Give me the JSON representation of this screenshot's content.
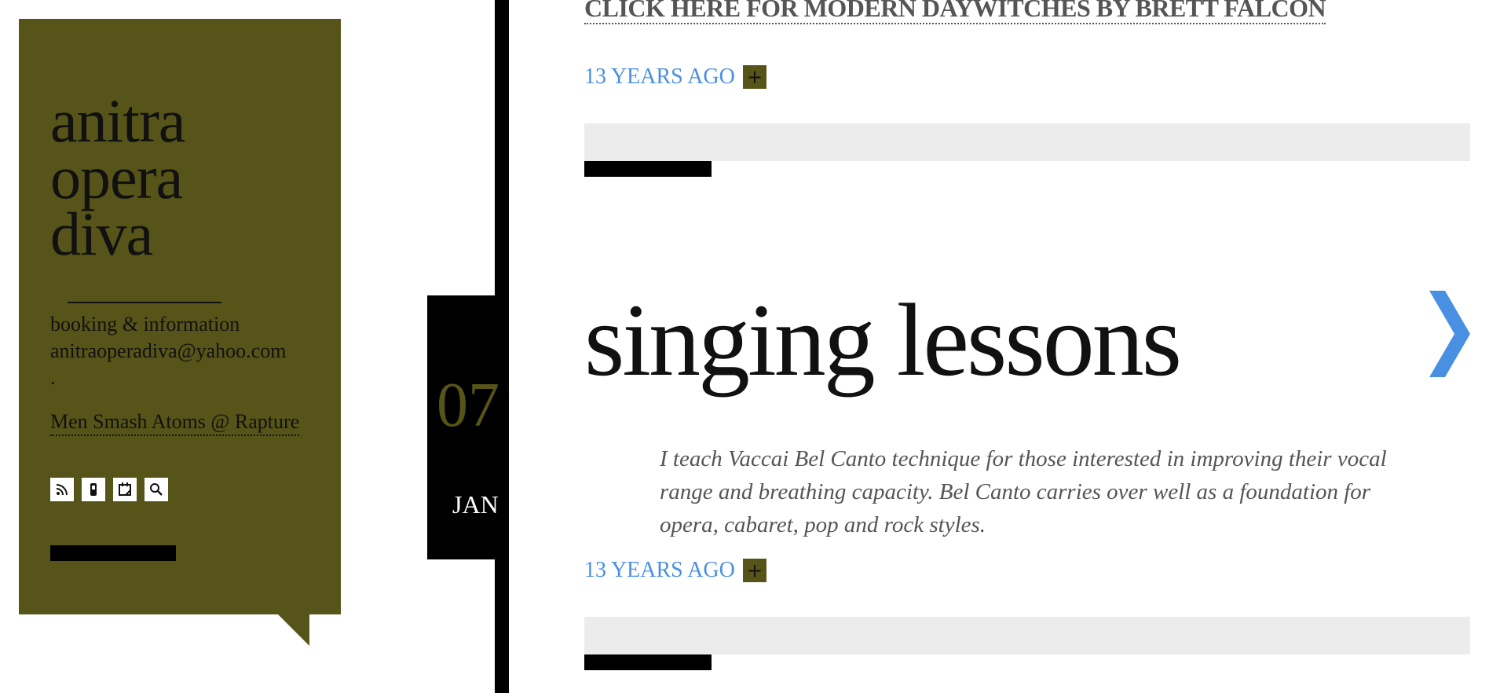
{
  "sidebar": {
    "logo_lines": [
      "anitra",
      "opera",
      "diva"
    ],
    "booking_label": "booking & information",
    "email": "anitraoperadiva@yahoo.com",
    "dot": ".",
    "link_label": "Men Smash Atoms @ Rapture",
    "icons": [
      "rss-icon",
      "phone-icon",
      "calendar-icon",
      "search-icon"
    ]
  },
  "date": {
    "day": "07",
    "month": "JAN"
  },
  "posts": {
    "top_link": "CLICK HERE FOR MODERN DAYWITCHES BY BRETT   FALCON",
    "top_meta": "13 YEARS AGO",
    "title": "singing lessons",
    "body": "I teach Vaccai Bel Canto technique for those interested in improving their vocal range and breathing capacity. Bel Canto carries over well as a foundation for opera, cabaret, pop and rock styles.",
    "post_meta": "13 YEARS AGO",
    "plus": "+"
  },
  "colors": {
    "olive": "#575419",
    "link_blue": "#4a90e2",
    "arrow_blue": "#4a90e2"
  }
}
